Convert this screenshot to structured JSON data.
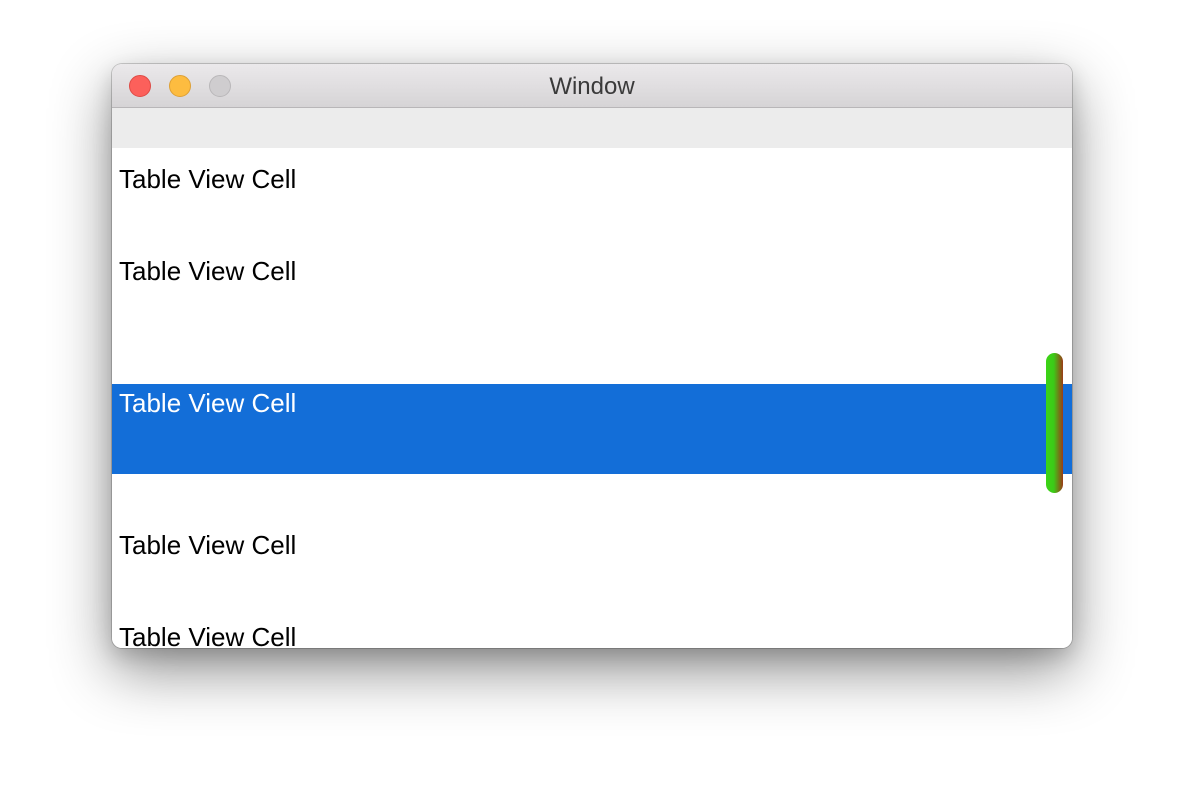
{
  "window": {
    "title": "Window"
  },
  "table": {
    "rows": [
      {
        "label": "Table View Cell",
        "selected": false
      },
      {
        "label": "Table View Cell",
        "selected": false
      },
      {
        "label": "Table View Cell",
        "selected": true
      },
      {
        "label": "Table View Cell",
        "selected": false
      },
      {
        "label": "Table View Cell",
        "selected": false
      }
    ]
  },
  "colors": {
    "selection": "#136ed8",
    "close_button": "#fc605b",
    "minimize_button": "#fdbc40",
    "zoom_button": "#cfcdcf",
    "scroller_green": "#3bd415",
    "scroller_brown": "#9b3b17"
  },
  "icons": {
    "close": "close-button-icon",
    "minimize": "minimize-button-icon",
    "zoom": "zoom-button-icon"
  }
}
